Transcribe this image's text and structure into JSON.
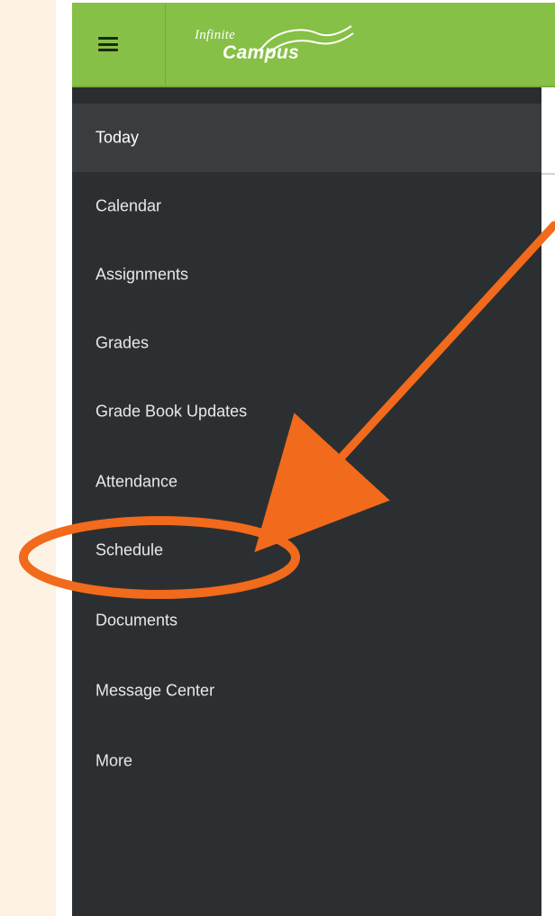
{
  "header": {
    "brand_top": "Infinite",
    "brand_bottom": "Campus",
    "colors": {
      "header_bg": "#86c046",
      "sidebar_bg": "#2c2f31",
      "active_bg": "#3a3d40",
      "page_bg": "#fdf2e4",
      "annotation": "#f26a1b"
    }
  },
  "sidebar": {
    "items": [
      {
        "label": "Today",
        "active": true
      },
      {
        "label": "Calendar",
        "active": false
      },
      {
        "label": "Assignments",
        "active": false
      },
      {
        "label": "Grades",
        "active": false
      },
      {
        "label": "Grade Book Updates",
        "active": false
      },
      {
        "label": "Attendance",
        "active": false
      },
      {
        "label": "Schedule",
        "active": false
      },
      {
        "label": "Documents",
        "active": false
      },
      {
        "label": "Message Center",
        "active": false
      },
      {
        "label": "More",
        "active": false
      }
    ]
  },
  "icons": {
    "menu": "hamburger-menu-icon",
    "logo": "infinite-campus-logo"
  }
}
